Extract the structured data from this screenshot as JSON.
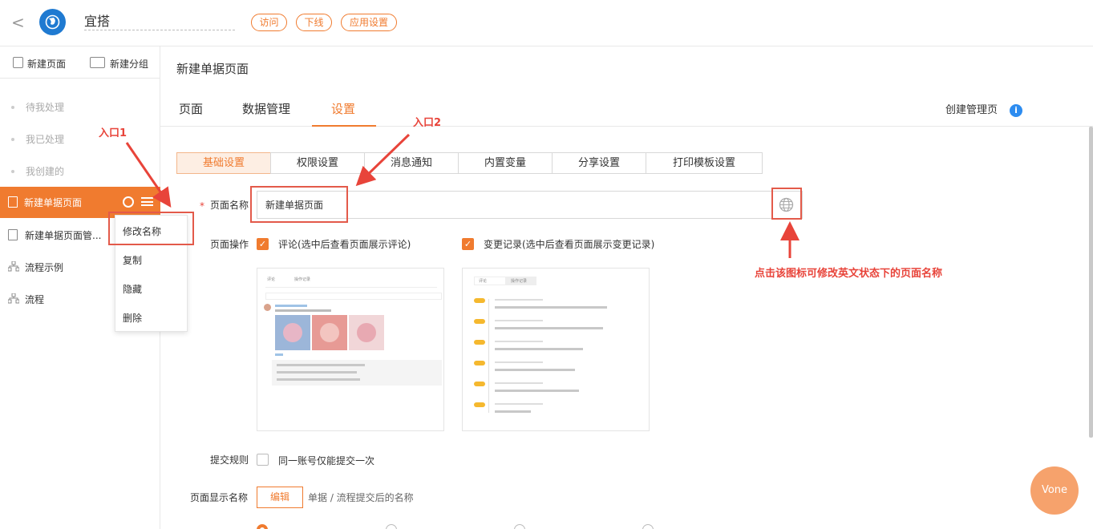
{
  "header": {
    "back_glyph": "<",
    "app_name": "宜搭",
    "buttons": [
      "访问",
      "下线",
      "应用设置"
    ]
  },
  "sidebar": {
    "new_page_label": "新建页面",
    "new_group_label": "新建分组",
    "muted_items": [
      "待我处理",
      "我已处理",
      "我创建的"
    ],
    "active_item": "新建单据页面",
    "items": [
      "新建单据页面管...",
      "流程示例",
      "流程"
    ]
  },
  "context_menu": [
    "修改名称",
    "复制",
    "隐藏",
    "删除"
  ],
  "main": {
    "page_title": "新建单据页面",
    "tabs": [
      "页面",
      "数据管理",
      "设置"
    ],
    "active_tab": "设置",
    "create_manage_page": "创建管理页",
    "subtabs": [
      "基础设置",
      "权限设置",
      "消息通知",
      "内置变量",
      "分享设置",
      "打印模板设置"
    ],
    "required_mark": "*",
    "page_name_label": "页面名称",
    "page_name_value": "新建单据页面",
    "page_ops_label": "页面操作",
    "comment_label": "评论(选中后查看页面展示评论)",
    "changelog_label": "变更记录(选中后查看页面展示变更记录)",
    "submit_rule_label": "提交规则",
    "submit_rule_option": "同一账号仅能提交一次",
    "display_name_label": "页面显示名称",
    "edit_button": "编辑",
    "display_name_hint": "单据 / 流程提交后的名称"
  },
  "previews": {
    "comment_tabs": [
      "评论",
      "操作记录"
    ],
    "log_tabs": [
      "评论",
      "操作记录"
    ]
  },
  "annotations": {
    "entry1": "入口1",
    "entry2": "入口2",
    "globe_hint": "点击该图标可修改英文状态下的页面名称"
  },
  "assistant": "Vone",
  "colors": {
    "accent": "#f07b2f",
    "annotation": "#e8443a",
    "logo": "#1f7ad1",
    "info": "#2d8cf0"
  }
}
